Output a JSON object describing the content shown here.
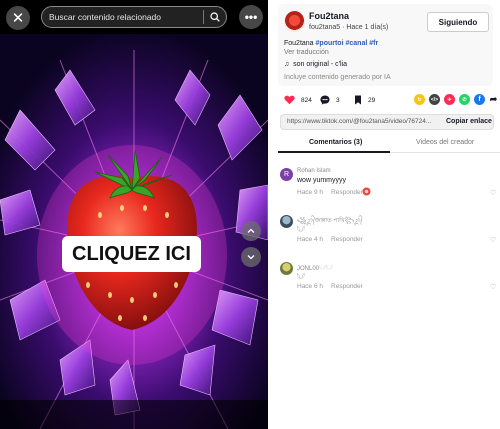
{
  "video": {
    "search_placeholder": "Buscar contenido relacionado",
    "overlay_text": "CLIQUEZ ICI"
  },
  "author": {
    "name": "Fou2tana",
    "meta": "fou2tana5 · Hace 1 día(s)",
    "follow_label": "Siguiendo",
    "caption_prefix": "Fou2tana ",
    "hashtags": [
      "#pourtoi",
      "#canal",
      "#fr"
    ],
    "see_translation": "Ver traducción",
    "music_icon": "♫",
    "music": "son original - c'lia",
    "ai_label": "Incluye contenido generado por IA"
  },
  "actions": {
    "likes": "824",
    "comments": "3",
    "saves": "29",
    "share_labels": [
      "</>",
      "✈"
    ]
  },
  "link": {
    "url": "https://www.tiktok.com/@fou2tana5/video/76724...",
    "copy_label": "Copiar enlace"
  },
  "tabs": {
    "comments": "Comentarios (3)",
    "creator_videos": "Videos del creador"
  },
  "comments": [
    {
      "user": "Rohan Islam",
      "avatar_letter": "R",
      "text": "wow yummyyyy",
      "time": "Hace 9 h",
      "reply": "Responder"
    },
    {
      "user": "꧁ᬊ᭄জান্নাত পাখি꧂ᬊ᭄",
      "text": "𓆩𓆪",
      "time": "Hace 4 h",
      "reply": "Responder"
    },
    {
      "user": "JONL00𓆩𓆪𓆩𓆪",
      "text": "𓆩𓆪",
      "time": "Hace 6 h",
      "reply": "Responder"
    }
  ],
  "colors": {
    "like_heart": "#fe2c55",
    "hashtag": "#2b5db9",
    "accent_dark": "#161823"
  }
}
